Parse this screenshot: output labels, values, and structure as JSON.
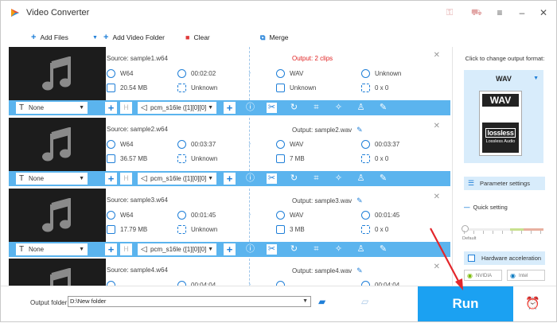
{
  "app": {
    "title": "Video Converter"
  },
  "toolbar": {
    "add_files": "Add Files",
    "add_folder": "Add Video Folder",
    "clear": "Clear",
    "merge": "Merge"
  },
  "items": [
    {
      "source": "Source: sample1.w64",
      "src_format": "W64",
      "src_duration": "00:02:02",
      "src_size": "20.54 MB",
      "src_resolution": "Unknown",
      "output": "Output: 2 clips",
      "out_format": "WAV",
      "out_duration": "Unknown",
      "out_size": "Unknown",
      "out_resolution": "0 x 0",
      "subtitle": "None",
      "audio": "pcm_s16le ([1][0][0]"
    },
    {
      "source": "Source: sample2.w64",
      "src_format": "W64",
      "src_duration": "00:03:37",
      "src_size": "36.57 MB",
      "src_resolution": "Unknown",
      "output": "Output: sample2.wav",
      "out_format": "WAV",
      "out_duration": "00:03:37",
      "out_size": "7 MB",
      "out_resolution": "0 x 0",
      "subtitle": "None",
      "audio": "pcm_s16le ([1][0][0]"
    },
    {
      "source": "Source: sample3.w64",
      "src_format": "W64",
      "src_duration": "00:01:45",
      "src_size": "17.79 MB",
      "src_resolution": "Unknown",
      "output": "Output: sample3.wav",
      "out_format": "WAV",
      "out_duration": "00:01:45",
      "out_size": "3 MB",
      "out_resolution": "0 x 0",
      "subtitle": "None",
      "audio": "pcm_s16le ([1][0][0]"
    },
    {
      "source": "Source: sample4.w64",
      "src_format": "",
      "src_duration": "00:04:04",
      "src_size": "",
      "src_resolution": "",
      "output": "Output: sample4.wav",
      "out_format": "",
      "out_duration": "00:04:04",
      "out_size": "",
      "out_resolution": "",
      "subtitle": "",
      "audio": ""
    }
  ],
  "right_panel": {
    "caption": "Click to change output format:",
    "format": "WAV",
    "format_badge_top": "WAV",
    "format_badge_lossless": "lossless",
    "format_badge_sub": "Lossless Audio",
    "parameter_settings": "Parameter settings",
    "quick_setting": "Quick setting",
    "slider_label": "Default",
    "quick_setting_level": 0,
    "hardware_acceleration": "Hardware acceleration",
    "gpu_nvidia": "NVIDIA",
    "gpu_intel": "Intel"
  },
  "bottom": {
    "output_folder_label": "Output folder:",
    "output_folder_value": "D:\\New folder",
    "run": "Run"
  },
  "colors": {
    "accent": "#1ba1f2",
    "strip": "#5bb4ee",
    "output_warning": "#e02222"
  }
}
